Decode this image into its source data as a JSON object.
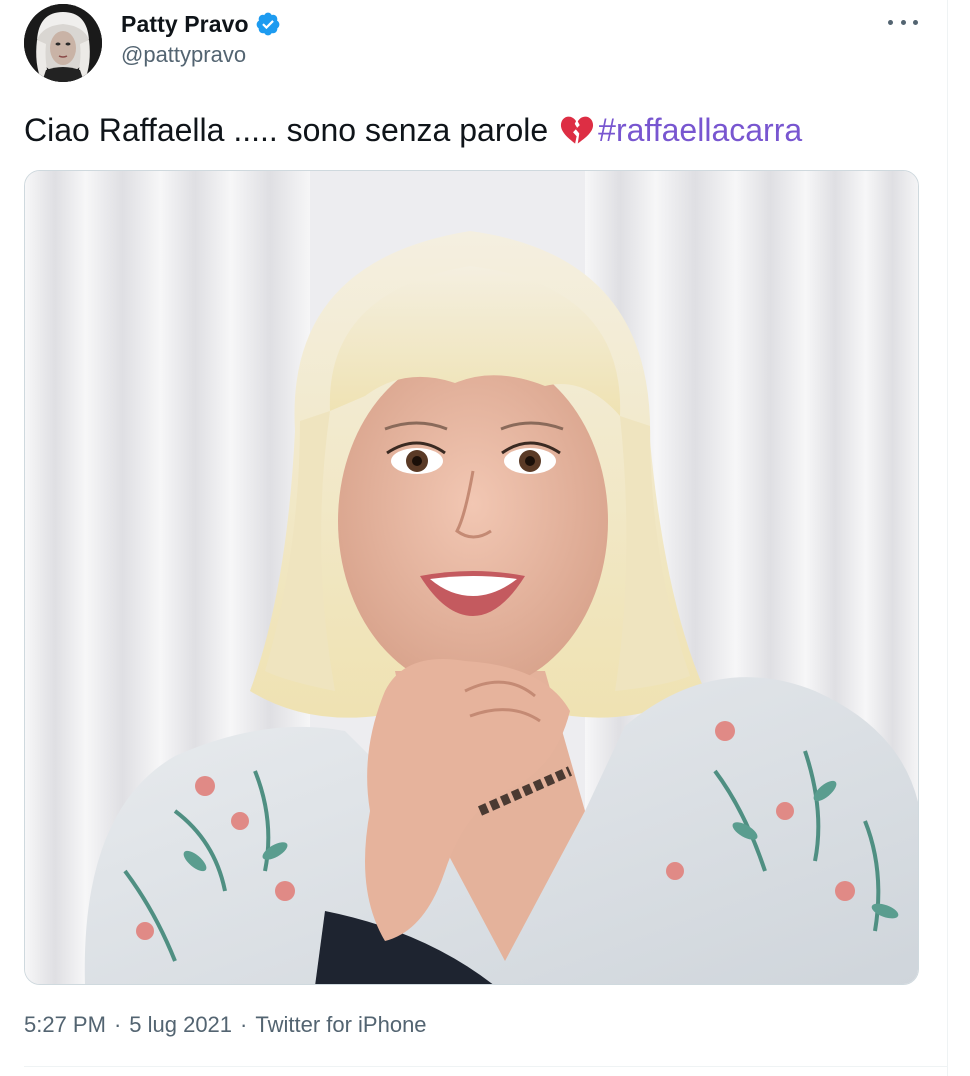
{
  "author": {
    "display_name": "Patty Pravo",
    "handle": "@pattypravo",
    "verified": true,
    "verified_icon": "verified-badge-icon",
    "avatar": "profile-avatar"
  },
  "more_menu_icon": "more-horizontal-icon",
  "tweet": {
    "text_main": "Ciao Raffaella ..... sono senza parole",
    "emoji": "broken-heart-icon",
    "hashtag": "#raffaellacarra"
  },
  "media": {
    "type": "photo",
    "icon": "tweet-photo"
  },
  "meta": {
    "time": "5:27 PM",
    "separator": "·",
    "date": "5 lug 2021",
    "source": "Twitter for iPhone"
  },
  "colors": {
    "hashtag": "#7856d0",
    "verified": "#1d9bf0",
    "secondary_text": "#536471"
  }
}
